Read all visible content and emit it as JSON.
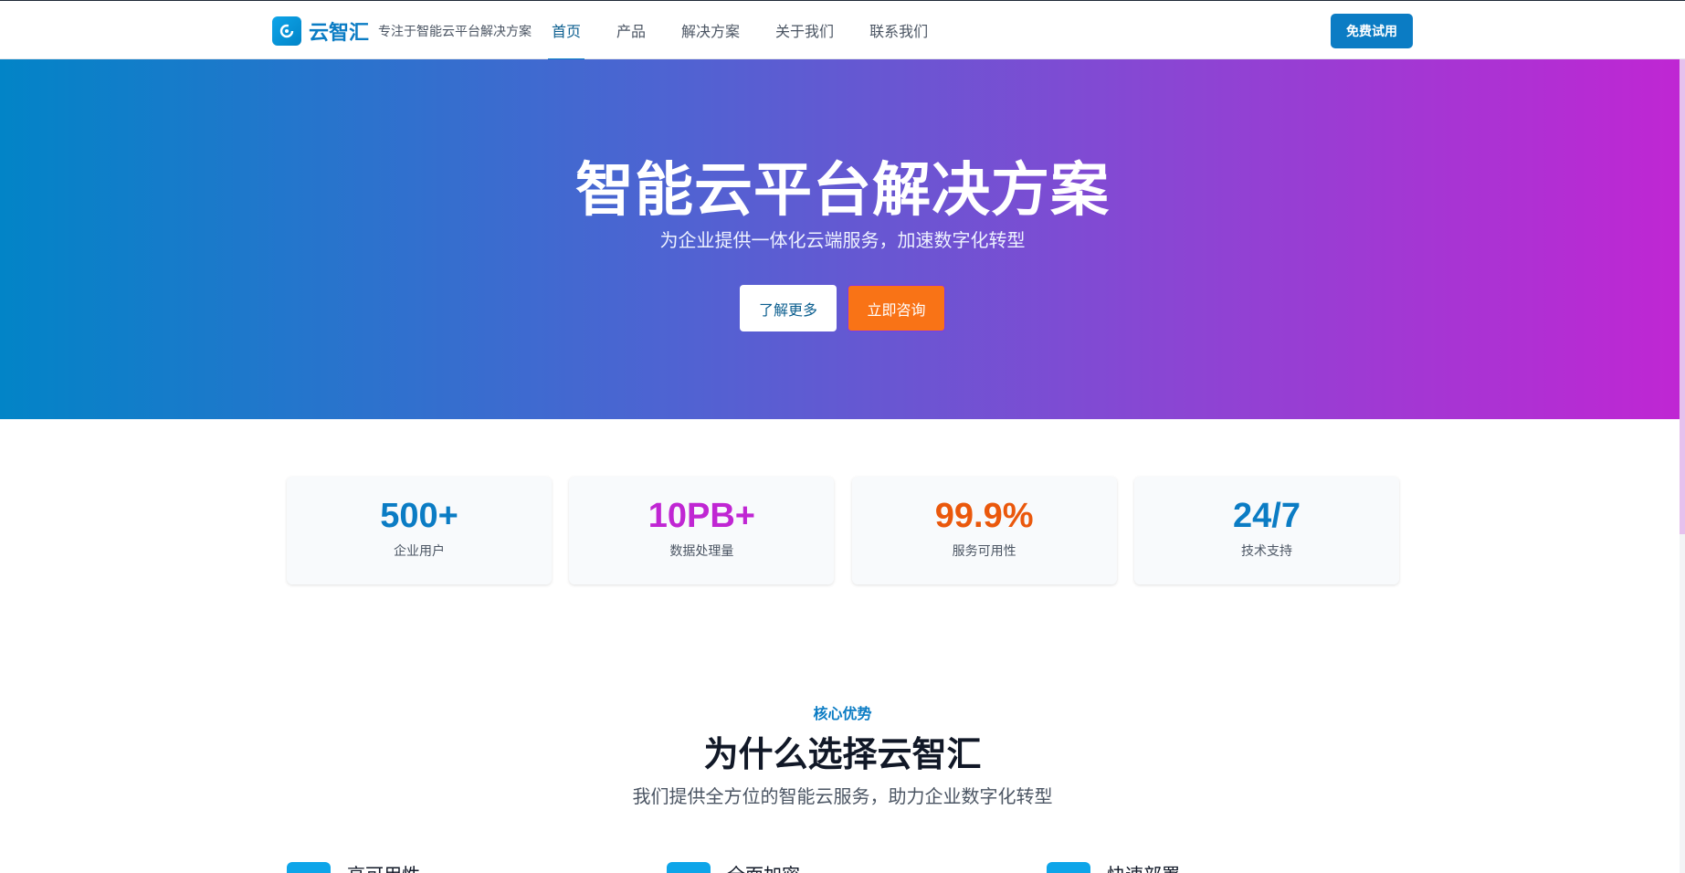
{
  "header": {
    "brand": "云智汇",
    "tagline": "专注于智能云平台解决方案",
    "nav": [
      {
        "label": "首页",
        "active": true
      },
      {
        "label": "产品",
        "active": false
      },
      {
        "label": "解决方案",
        "active": false
      },
      {
        "label": "关于我们",
        "active": false
      },
      {
        "label": "联系我们",
        "active": false
      }
    ],
    "trial_label": "免费试用",
    "brand_color": "#0b7cc4"
  },
  "hero": {
    "title": "智能云平台解决方案",
    "subtitle": "为企业提供一体化云端服务，加速数字化转型",
    "learn_more_label": "了解更多",
    "consult_label": "立即咨询",
    "gradient": [
      "#0284c7",
      "#c026d3"
    ]
  },
  "stats": [
    {
      "value": "500+",
      "label": "企业用户",
      "color": "#0b7cc4"
    },
    {
      "value": "10PB+",
      "label": "数据处理量",
      "color": "#c026d3"
    },
    {
      "value": "99.9%",
      "label": "服务可用性",
      "color": "#ea580c"
    },
    {
      "value": "24/7",
      "label": "技术支持",
      "color": "#0b7cc4"
    }
  ],
  "why": {
    "kicker": "核心优势",
    "title": "为什么选择云智汇",
    "subtitle": "我们提供全方位的智能云服务，助力企业数字化转型"
  },
  "features": [
    {
      "title": "高可用性"
    },
    {
      "title": "全面加密"
    },
    {
      "title": "快速部署"
    }
  ]
}
